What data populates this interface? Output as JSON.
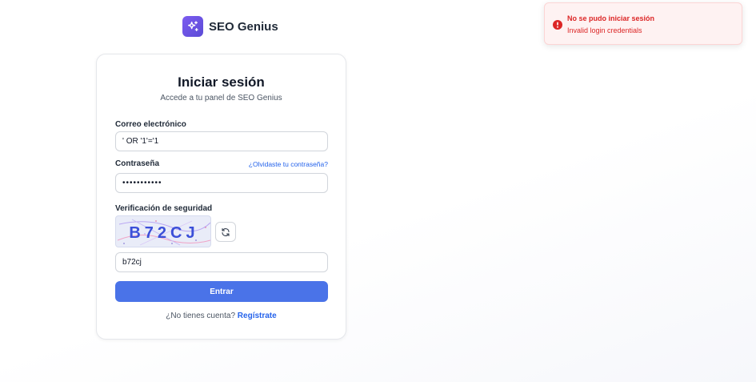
{
  "brand": {
    "name": "SEO Genius",
    "logo_icon": "sparkles-icon",
    "logo_color": "#6d55e6"
  },
  "login": {
    "title": "Iniciar sesión",
    "subtitle": "Accede a tu panel de SEO Genius",
    "email_label": "Correo electrónico",
    "email_value": "' OR '1'='1",
    "password_label": "Contraseña",
    "password_value": "•••••••••••",
    "forgot_link": "¿Olvidaste tu contraseña?",
    "captcha_label": "Verificación de seguridad",
    "captcha_text": "B72CJ",
    "captcha_refresh_icon": "refresh-icon",
    "captcha_value": "b72cj",
    "submit_label": "Entrar",
    "signup_prompt": "¿No tienes cuenta?",
    "signup_link": "Regístrate"
  },
  "toast": {
    "title": "No se pudo iniciar sesión",
    "message": "Invalid login credentials",
    "icon": "error-icon",
    "color": "#dc2626"
  },
  "colors": {
    "accent": "#4a73e8",
    "link": "#2563eb",
    "error": "#dc2626"
  }
}
